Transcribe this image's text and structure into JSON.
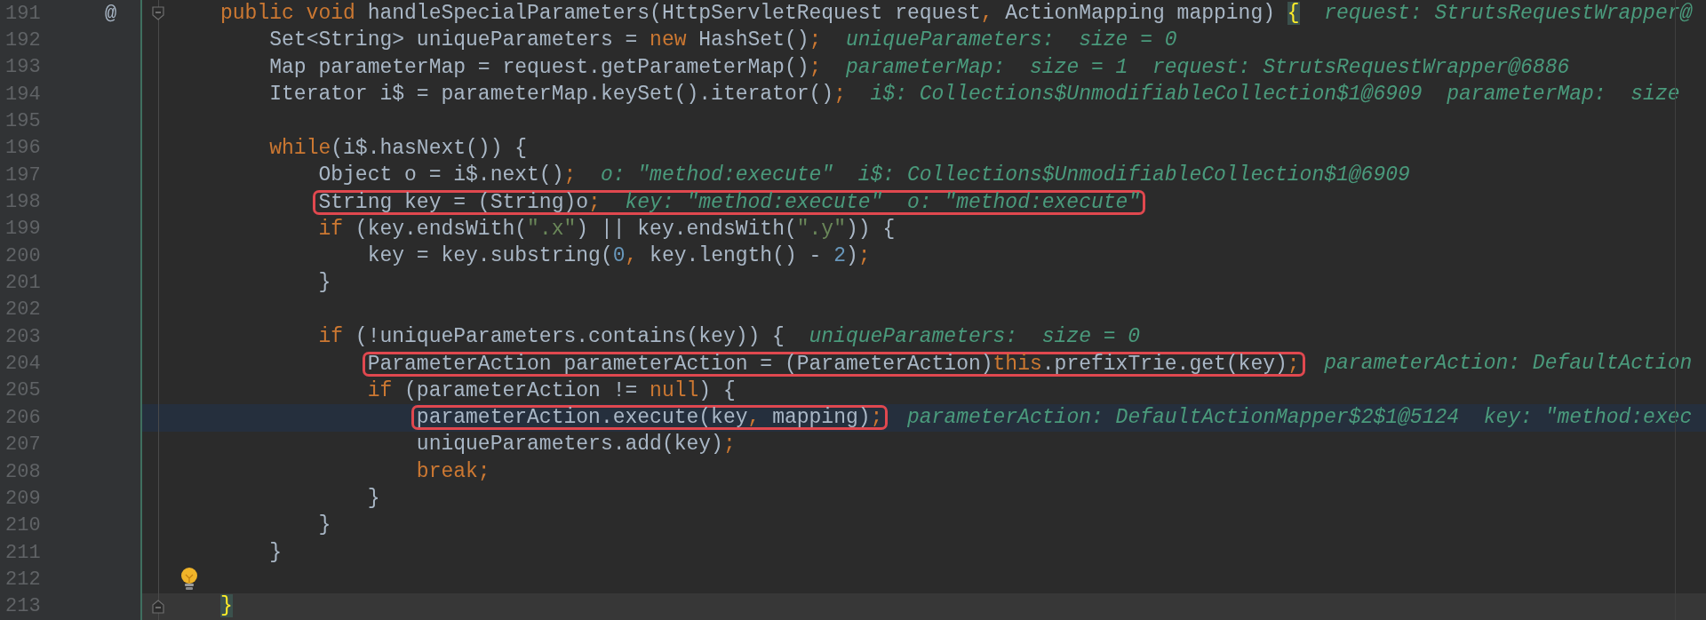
{
  "lines": [
    {
      "number": "191",
      "gutter_text": "@",
      "fold_start": true,
      "fold_end": false,
      "bulb": false,
      "execution_point": false,
      "caret_line": false,
      "segments": [
        {
          "boxed": false,
          "tokens": [
            {
              "kind": "keyword",
              "text": "public void"
            },
            {
              "kind": "plain",
              "text": " handleSpecialParameters(HttpServletRequest request"
            },
            {
              "kind": "punct",
              "text": ","
            },
            {
              "kind": "plain",
              "text": " ActionMapping mapping) "
            },
            {
              "kind": "brace",
              "text": "{"
            },
            {
              "kind": "hint",
              "text": "request: StrutsRequestWrapper@"
            }
          ]
        }
      ]
    },
    {
      "number": "192",
      "fold_start": false,
      "fold_end": false,
      "bulb": false,
      "execution_point": false,
      "caret_line": false,
      "segments": [
        {
          "boxed": false,
          "tokens": [
            {
              "kind": "plain",
              "text": "    Set<String> uniqueParameters = "
            },
            {
              "kind": "keyword",
              "text": "new"
            },
            {
              "kind": "plain",
              "text": " HashSet()"
            },
            {
              "kind": "punct",
              "text": ";"
            },
            {
              "kind": "hint",
              "text": "uniqueParameters:  size = 0"
            }
          ]
        }
      ]
    },
    {
      "number": "193",
      "fold_start": false,
      "fold_end": false,
      "bulb": false,
      "execution_point": false,
      "caret_line": false,
      "segments": [
        {
          "boxed": false,
          "tokens": [
            {
              "kind": "plain",
              "text": "    Map parameterMap = request.getParameterMap()"
            },
            {
              "kind": "punct",
              "text": ";"
            },
            {
              "kind": "hint",
              "text": "parameterMap:  size = 1  request: StrutsRequestWrapper@6886"
            }
          ]
        }
      ]
    },
    {
      "number": "194",
      "fold_start": false,
      "fold_end": false,
      "bulb": false,
      "execution_point": false,
      "caret_line": false,
      "segments": [
        {
          "boxed": false,
          "tokens": [
            {
              "kind": "plain",
              "text": "    Iterator i$ = parameterMap.keySet().iterator()"
            },
            {
              "kind": "punct",
              "text": ";"
            },
            {
              "kind": "hint",
              "text": "i$: Collections$UnmodifiableCollection$1@6909  parameterMap:  size"
            }
          ]
        }
      ]
    },
    {
      "number": "195",
      "fold_start": false,
      "fold_end": false,
      "bulb": false,
      "execution_point": false,
      "caret_line": false
    },
    {
      "number": "196",
      "fold_start": false,
      "fold_end": false,
      "bulb": false,
      "execution_point": false,
      "caret_line": false,
      "segments": [
        {
          "boxed": false,
          "tokens": [
            {
              "kind": "keyword",
              "text": "    while"
            },
            {
              "kind": "plain",
              "text": "(i$.hasNext()) {"
            }
          ]
        }
      ]
    },
    {
      "number": "197",
      "fold_start": false,
      "fold_end": false,
      "bulb": false,
      "execution_point": false,
      "caret_line": false,
      "segments": [
        {
          "boxed": false,
          "tokens": [
            {
              "kind": "plain",
              "text": "        Object o = i$.next()"
            },
            {
              "kind": "punct",
              "text": ";"
            },
            {
              "kind": "hint",
              "text": "o: \"method:execute\"  i$: Collections$UnmodifiableCollection$1@6909"
            }
          ]
        }
      ]
    },
    {
      "number": "198",
      "fold_start": false,
      "fold_end": false,
      "bulb": false,
      "execution_point": false,
      "caret_line": false,
      "segments": [
        {
          "boxed": true,
          "tokens": [
            {
              "kind": "plain",
              "text": "        String key = (String)o"
            },
            {
              "kind": "punct",
              "text": ";"
            },
            {
              "kind": "hint",
              "text": "key: \"method:execute\"  o: \"method:execute\""
            }
          ]
        }
      ]
    },
    {
      "number": "199",
      "fold_start": false,
      "fold_end": false,
      "bulb": false,
      "execution_point": false,
      "caret_line": false,
      "segments": [
        {
          "boxed": false,
          "tokens": [
            {
              "kind": "keyword",
              "text": "        if"
            },
            {
              "kind": "plain",
              "text": " (key.endsWith("
            },
            {
              "kind": "string",
              "text": "\".x\""
            },
            {
              "kind": "plain",
              "text": ") || key.endsWith("
            },
            {
              "kind": "string",
              "text": "\".y\""
            },
            {
              "kind": "plain",
              "text": ")) {"
            }
          ]
        }
      ]
    },
    {
      "number": "200",
      "fold_start": false,
      "fold_end": false,
      "bulb": false,
      "execution_point": false,
      "caret_line": false,
      "segments": [
        {
          "boxed": false,
          "tokens": [
            {
              "kind": "plain",
              "text": "            key = key.substring("
            },
            {
              "kind": "number",
              "text": "0"
            },
            {
              "kind": "punct",
              "text": ","
            },
            {
              "kind": "plain",
              "text": " key.length() - "
            },
            {
              "kind": "number",
              "text": "2"
            },
            {
              "kind": "plain",
              "text": ")"
            },
            {
              "kind": "punct",
              "text": ";"
            }
          ]
        }
      ]
    },
    {
      "number": "201",
      "fold_start": false,
      "fold_end": false,
      "bulb": false,
      "execution_point": false,
      "caret_line": false,
      "segments": [
        {
          "boxed": false,
          "tokens": [
            {
              "kind": "plain",
              "text": "        }"
            }
          ]
        }
      ]
    },
    {
      "number": "202",
      "fold_start": false,
      "fold_end": false,
      "bulb": false,
      "execution_point": false,
      "caret_line": false
    },
    {
      "number": "203",
      "fold_start": false,
      "fold_end": false,
      "bulb": false,
      "execution_point": false,
      "caret_line": false,
      "segments": [
        {
          "boxed": false,
          "tokens": [
            {
              "kind": "keyword",
              "text": "        if"
            },
            {
              "kind": "plain",
              "text": " (!uniqueParameters.contains(key)) {"
            },
            {
              "kind": "hint",
              "text": "uniqueParameters:  size = 0"
            }
          ]
        }
      ]
    },
    {
      "number": "204",
      "fold_start": false,
      "fold_end": false,
      "bulb": false,
      "execution_point": false,
      "caret_line": false,
      "segments": [
        {
          "boxed": true,
          "tokens": [
            {
              "kind": "plain",
              "text": "            ParameterAction parameterAction = (ParameterAction)"
            },
            {
              "kind": "keyword",
              "text": "this"
            },
            {
              "kind": "plain",
              "text": ".prefixTrie.get(key)"
            },
            {
              "kind": "punct",
              "text": ";"
            }
          ]
        },
        {
          "boxed": false,
          "tokens": [
            {
              "kind": "hint",
              "text": "parameterAction: DefaultAction"
            }
          ]
        }
      ]
    },
    {
      "number": "205",
      "fold_start": false,
      "fold_end": false,
      "bulb": false,
      "execution_point": false,
      "caret_line": false,
      "segments": [
        {
          "boxed": false,
          "tokens": [
            {
              "kind": "keyword",
              "text": "            if"
            },
            {
              "kind": "plain",
              "text": " (parameterAction != "
            },
            {
              "kind": "keyword",
              "text": "null"
            },
            {
              "kind": "plain",
              "text": ") {"
            }
          ]
        }
      ]
    },
    {
      "number": "206",
      "fold_start": false,
      "fold_end": false,
      "bulb": false,
      "execution_point": true,
      "caret_line": false,
      "segments": [
        {
          "boxed": true,
          "tokens": [
            {
              "kind": "plain",
              "text": "                parameterAction.execute(key"
            },
            {
              "kind": "punct",
              "text": ","
            },
            {
              "kind": "plain",
              "text": " mapping)"
            },
            {
              "kind": "punct",
              "text": ";"
            }
          ]
        },
        {
          "boxed": false,
          "tokens": [
            {
              "kind": "hint",
              "text": "parameterAction: DefaultActionMapper$2$1@5124  key: \"method:exec"
            }
          ]
        }
      ]
    },
    {
      "number": "207",
      "fold_start": false,
      "fold_end": false,
      "bulb": false,
      "execution_point": false,
      "caret_line": false,
      "segments": [
        {
          "boxed": false,
          "tokens": [
            {
              "kind": "plain",
              "text": "                uniqueParameters.add(key)"
            },
            {
              "kind": "punct",
              "text": ";"
            }
          ]
        }
      ]
    },
    {
      "number": "208",
      "fold_start": false,
      "fold_end": false,
      "bulb": false,
      "execution_point": false,
      "caret_line": false,
      "segments": [
        {
          "boxed": false,
          "tokens": [
            {
              "kind": "keyword",
              "text": "                break"
            },
            {
              "kind": "punct",
              "text": ";"
            }
          ]
        }
      ]
    },
    {
      "number": "209",
      "fold_start": false,
      "fold_end": false,
      "bulb": false,
      "execution_point": false,
      "caret_line": false,
      "segments": [
        {
          "boxed": false,
          "tokens": [
            {
              "kind": "plain",
              "text": "            }"
            }
          ]
        }
      ]
    },
    {
      "number": "210",
      "fold_start": false,
      "fold_end": false,
      "bulb": false,
      "execution_point": false,
      "caret_line": false,
      "segments": [
        {
          "boxed": false,
          "tokens": [
            {
              "kind": "plain",
              "text": "        }"
            }
          ]
        }
      ]
    },
    {
      "number": "211",
      "fold_start": false,
      "fold_end": false,
      "bulb": false,
      "execution_point": false,
      "caret_line": false,
      "segments": [
        {
          "boxed": false,
          "tokens": [
            {
              "kind": "plain",
              "text": "    }"
            }
          ]
        }
      ]
    },
    {
      "number": "212",
      "fold_start": false,
      "fold_end": false,
      "bulb": true,
      "execution_point": false,
      "caret_line": false
    },
    {
      "number": "213",
      "fold_start": false,
      "fold_end": true,
      "bulb": false,
      "execution_point": false,
      "caret_line": true,
      "segments": [
        {
          "boxed": false,
          "tokens": [
            {
              "kind": "brace",
              "text": "}"
            }
          ]
        }
      ]
    }
  ]
}
